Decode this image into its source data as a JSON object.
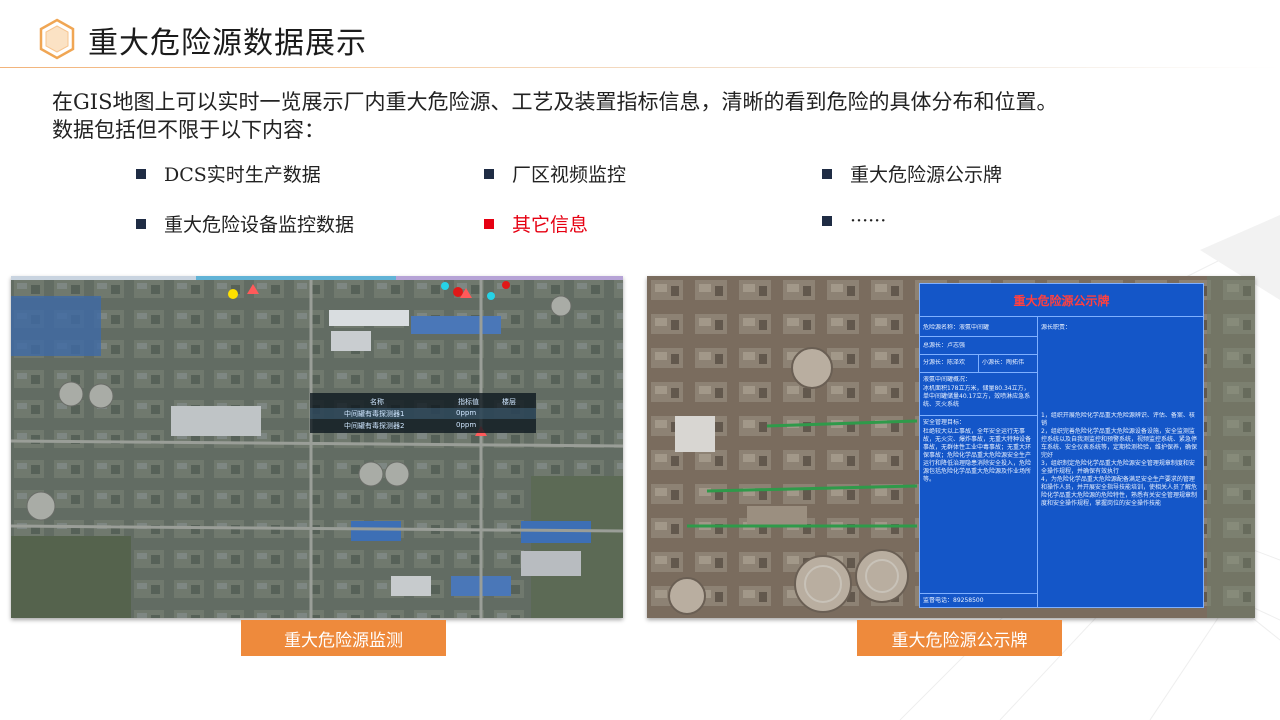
{
  "header": {
    "title": "重大危险源数据展示"
  },
  "intro": {
    "line1": "在GIS地图上可以实时一览展示厂内重大危险源、工艺及装置指标信息，清晰的看到危险的具体分布和位置。",
    "line2": "数据包括但不限于以下内容："
  },
  "bullets": [
    {
      "text": "DCS实时生产数据"
    },
    {
      "text": "厂区视频监控"
    },
    {
      "text": "重大危险源公示牌"
    },
    {
      "text": "重大危险设备监控数据"
    },
    {
      "text": "其它信息"
    },
    {
      "text": "······"
    }
  ],
  "gis_tooltip": {
    "headers": [
      "名称",
      "指标值",
      "楼层"
    ],
    "rows": [
      {
        "name": "中间罐有毒探测器1",
        "value": "0ppm"
      },
      {
        "name": "中间罐有毒探测器2",
        "value": "0ppm"
      }
    ]
  },
  "notice_board": {
    "title": "重大危险源公示牌",
    "name_label": "危险源名称：液氨中间罐",
    "owner_label": "源长职责：",
    "chief": "总源长：卢志强",
    "sub1": "分源长：陈泽欢",
    "sub2": "小源长：陶拓伟",
    "overview_title": "液氨中间罐概况：",
    "overview_text": "冰机面积178立方米，储量80.34立方，单中间罐储量40.17立方，效喷淋应急系统、灭火系统",
    "goal_title": "安全管理目标：",
    "goal_text": "杜绝较大以上事故，全年安全运行无事故，无火灾、爆炸事故，无重大特种设备事故，无群体性工业中毒事故；无重大环保事故；危险化学品重大危险源安全生产运行和降低治理隐患消除安全投入，危险源包括危险化学品重大危险源及作业场所等。",
    "phone": "监督电话：89258500",
    "duties": "1，组织开展危险化学品重大危险源辨识、评估、备案、核销\n2，组织完善危险化学品重大危险源设备设施，安全监测监控系统以及自我测监控和预警系统，视频监控系统、紧急停车系统、安全仪表系统等，定期检测检验，维护保养，确保完好\n3，组织制定危险化学品重大危险源安全管理规章制度和安全操作规程，并确保有效执行\n4，为危险化学品重大危险源配备满足安全生产要求的管理和操作人员，并开展安全指导技能培训，使相关人员了解危险化学品重大危险源的危险特性，熟悉有关安全管理规章制度和安全操作规程，掌握岗位的安全操作技能"
  },
  "captions": {
    "left": "重大危险源监测",
    "right": "重大危险源公示牌"
  },
  "colors": {
    "accent_orange": "#ee8a3c",
    "bullet_dark": "#1f2c44",
    "bullet_red": "#e60012",
    "board_blue": "#1456c8"
  }
}
